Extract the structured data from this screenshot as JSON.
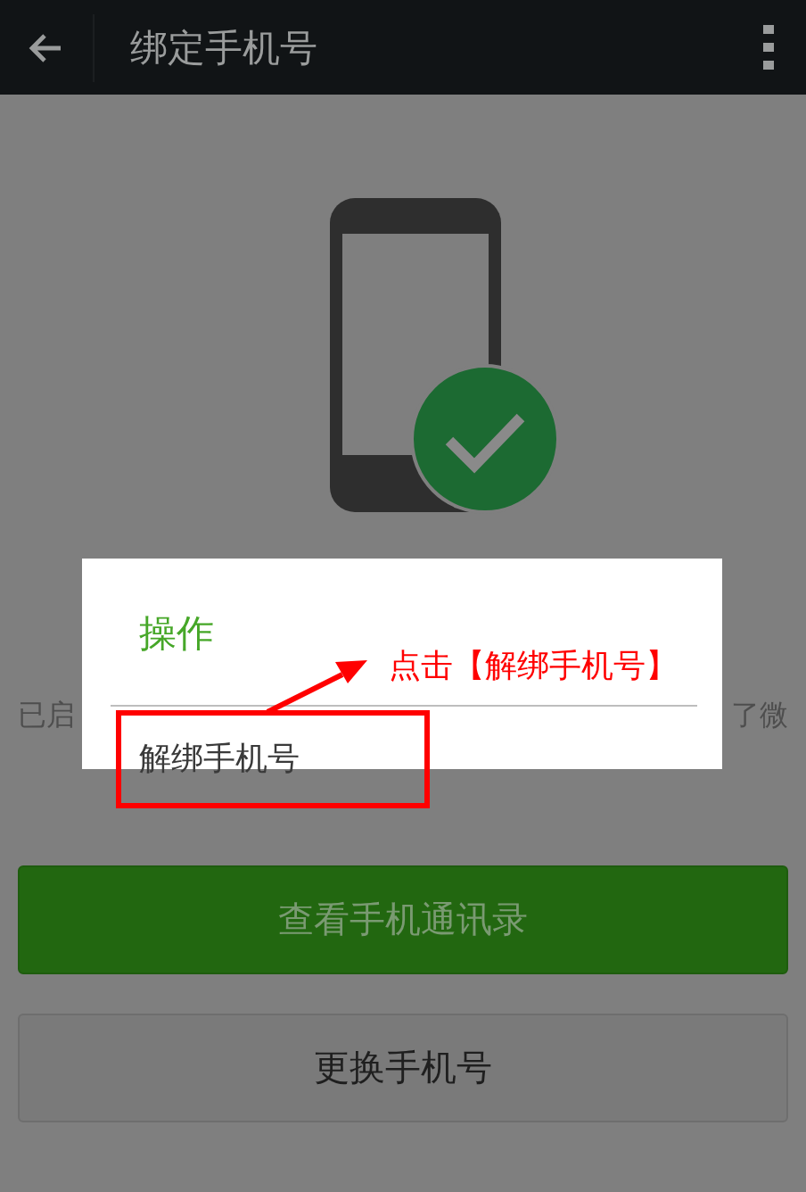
{
  "app_bar": {
    "title": "绑定手机号"
  },
  "status_text": {
    "left": "已启",
    "right": "了微"
  },
  "buttons": [
    {
      "label": "查看手机通讯录",
      "kind": "primary"
    },
    {
      "label": "更换手机号",
      "kind": "secondary"
    }
  ],
  "dialog": {
    "title": "操作",
    "items": [
      {
        "label": "解绑手机号",
        "highlighted": true
      }
    ]
  },
  "annotation": {
    "text": "点击【解绑手机号】"
  }
}
